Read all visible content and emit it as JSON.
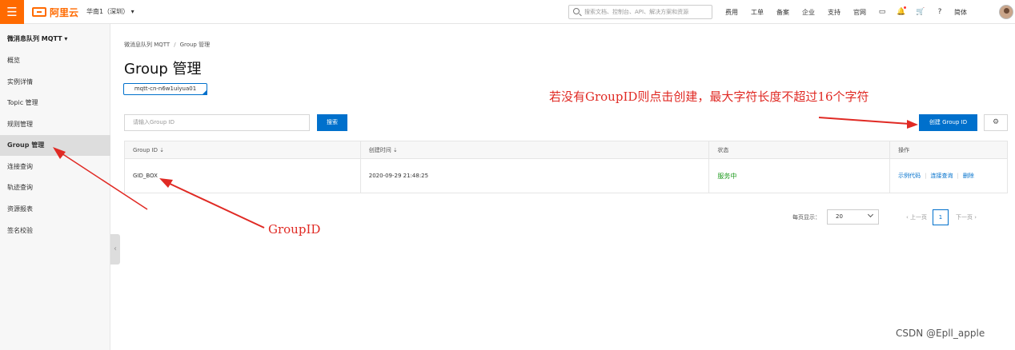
{
  "topbar": {
    "menu_icon": "☰",
    "brand": "阿里云",
    "region": "华南1（深圳） ▾",
    "search_placeholder": "搜索文档、控制台、API、解决方案和资源",
    "links": [
      "费用",
      "工单",
      "备案",
      "企业",
      "支持",
      "官网"
    ],
    "icons": [
      "console-icon",
      "bell-icon",
      "cart-icon",
      "help-icon"
    ],
    "language": "简体"
  },
  "sidebar": {
    "product": "微消息队列 MQTT ▾",
    "items": [
      "概览",
      "实例详情",
      "Topic 管理",
      "规则管理",
      "Group 管理",
      "连接查询",
      "轨迹查询",
      "资源报表",
      "签名校验"
    ],
    "active_index": 4,
    "collapse_icon": "‹"
  },
  "main": {
    "breadcrumb": [
      "微消息队列 MQTT",
      "Group 管理"
    ],
    "title": "Group 管理",
    "instance": "mqtt-cn-n6w1uiyua01",
    "filter_placeholder": "请输入Group ID",
    "search_button": "搜索",
    "create_button": "创建 Group ID",
    "settings_icon": "⚙",
    "table": {
      "headers": [
        "Group ID ⇣",
        "创建时间 ⇣",
        "状态",
        "操作"
      ],
      "rows": [
        {
          "group_id": "GID_BOX",
          "created": "2020-09-29 21:48:25",
          "status": "服务中",
          "ops": [
            "示例代码",
            "连接查询",
            "删除"
          ]
        }
      ]
    },
    "pagination": {
      "page_size_label": "每页显示：",
      "page_size": "20",
      "prev": "‹ 上一页",
      "current_page": "1",
      "next": "下一页 ›"
    }
  },
  "annotations": {
    "top_note": "若没有GroupID则点击创建，最大字符长度不超过16个字符",
    "bottom_note": "GroupID",
    "watermark": "CSDN @Epll_apple",
    "arrow_color": "#e02a24"
  }
}
